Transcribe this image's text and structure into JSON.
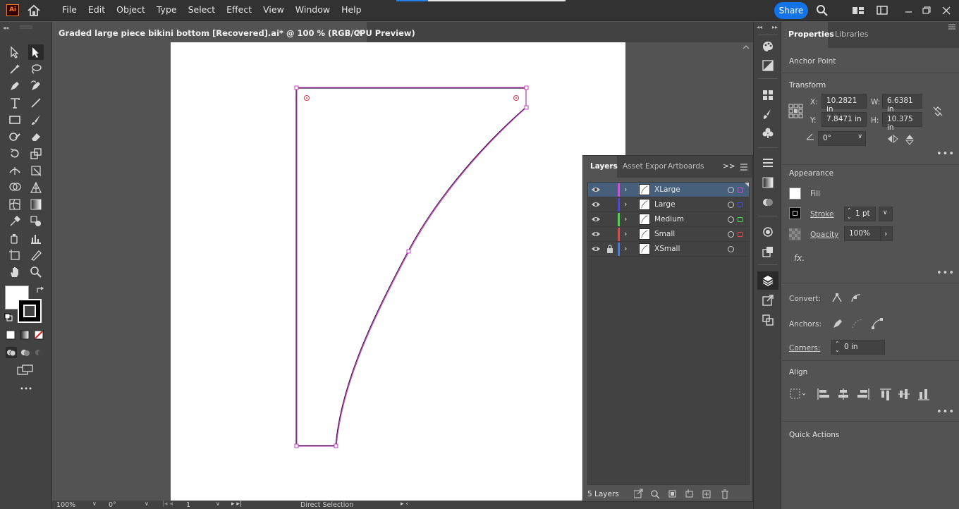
{
  "app": {
    "logo": "Ai"
  },
  "menu": [
    "File",
    "Edit",
    "Object",
    "Type",
    "Select",
    "Effect",
    "View",
    "Window",
    "Help"
  ],
  "top_right": {
    "share_label": "Share"
  },
  "document": {
    "tab_title": "Graded large piece bikini bottom [Recovered].ai* @ 100 % (RGB/CPU Preview)",
    "close_glyph": "×"
  },
  "statusbar": {
    "zoom": "100%",
    "rotation": "0°",
    "artboard_num": "1",
    "tool_name": "Direct Selection"
  },
  "layers_panel": {
    "tabs": [
      "Layers",
      "Asset Expor",
      "Artboards"
    ],
    "expand_glyph": ">>",
    "layers": [
      {
        "name": "XLarge",
        "color": "#d94ad9",
        "selected": true,
        "locked": false
      },
      {
        "name": "Large",
        "color": "#4a4ad9",
        "selected": false,
        "locked": false
      },
      {
        "name": "Medium",
        "color": "#4ad94a",
        "selected": false,
        "locked": false
      },
      {
        "name": "Small",
        "color": "#d94a4a",
        "selected": false,
        "locked": false
      },
      {
        "name": "XSmall",
        "color": "#4a7ad9",
        "selected": false,
        "locked": true
      }
    ],
    "count_label": "5 Layers"
  },
  "properties_panel": {
    "tabs": [
      "Properties",
      "Libraries"
    ],
    "selection_type": "Anchor Point",
    "transform": {
      "title": "Transform",
      "x_label": "X:",
      "x_value": "10.2821 in",
      "y_label": "Y:",
      "y_value": "7.8471 in",
      "w_label": "W:",
      "w_value": "6.6381 in",
      "h_label": "H:",
      "h_value": "10.375 in",
      "angle_value": "0°"
    },
    "appearance": {
      "title": "Appearance",
      "fill_label": "Fill",
      "stroke_label": "Stroke",
      "stroke_value": "1 pt",
      "opacity_label": "Opacity",
      "opacity_value": "100%",
      "fx_label": "fx."
    },
    "convert_label": "Convert:",
    "anchors_label": "Anchors:",
    "corners_label": "Corners:",
    "corners_value": "0 in",
    "align_title": "Align",
    "quick_actions_title": "Quick Actions"
  },
  "colors": {
    "accent": "#1473e6",
    "path": "#c83cc8",
    "selection_row": "#46607c"
  }
}
